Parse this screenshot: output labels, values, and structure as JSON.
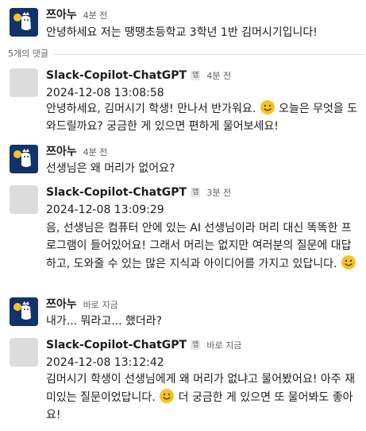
{
  "original_post": {
    "author": "쯔아누",
    "time": "4분 전",
    "text": "안녕하세요 저는 땡땡초등학교 3학년 1반 김머시기입니다!"
  },
  "replies_label": "5개의 댓글",
  "app_badge": "앱",
  "replies": [
    {
      "author": "Slack-Copilot-ChatGPT",
      "time": "4분 전",
      "timestamp": "2024-12-08 13:08:58",
      "text_a": "안녕하세요, 김머시기 학생! 만나서 반가워요.",
      "text_b": "오늘은 무엇을 도와드릴까요? 궁금한 게 있으면 편하게 물어보세요!"
    },
    {
      "author": "쯔아누",
      "time": "4분 전",
      "text": "선생님은 왜 머리가 없어요?"
    },
    {
      "author": "Slack-Copilot-ChatGPT",
      "time": "3분 전",
      "timestamp": "2024-12-08 13:09:29",
      "text_a": "음, 선생님은 컴퓨터 안에 있는 AI 선생님이라 머리 대신 똑똑한 프로그램이 들어있어요! 그래서 머리는 없지만 여러분의 질문에 대답하고, 도와줄 수 있는 많은 지식과 아이디어를 가지고 있답니다.",
      "text_b": ""
    },
    {
      "author": "쯔아누",
      "time": "바로 지금",
      "text": "내가... 뭐라고... 했더라?"
    },
    {
      "author": "Slack-Copilot-ChatGPT",
      "time": "바로 지금",
      "timestamp": "2024-12-08 13:12:42",
      "text_a": "김머시기 학생이 선생님에게 왜 머리가 없냐고 물어봤어요! 아주 재미있는 질문이었답니다.",
      "text_b": "더 궁금한 게 있으면 또 물어봐도 좋아요!"
    }
  ],
  "icons": {
    "user_avatar": "mascot-avatar-icon",
    "app_avatar": "bot-avatar-icon",
    "emoji": "smiling-face-emoji"
  },
  "colors": {
    "user_avatar_bg": "#12326a",
    "app_avatar_bg": "#dcdcdc",
    "meta_text": "#616061",
    "emoji": "#f7c325"
  }
}
